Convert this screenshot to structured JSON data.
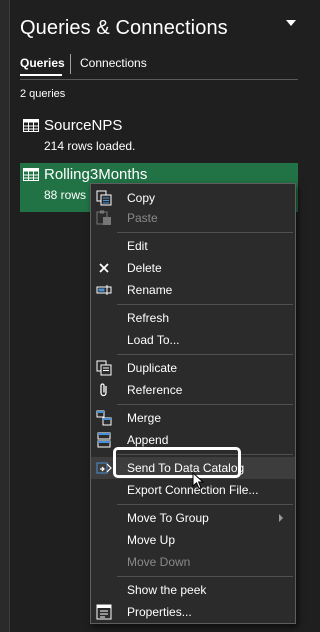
{
  "pane": {
    "title": "Queries & Connections",
    "tabs": [
      {
        "label": "Queries",
        "active": true
      },
      {
        "label": "Connections",
        "active": false
      }
    ],
    "count_text": "2 queries"
  },
  "queries": [
    {
      "name": "SourceNPS",
      "status": "214 rows loaded.",
      "selected": false
    },
    {
      "name": "Rolling3Months",
      "status": "88 rows",
      "selected": true
    }
  ],
  "context_menu": {
    "items": [
      {
        "label": "Copy",
        "icon": "copy-icon",
        "enabled": true
      },
      {
        "label": "Paste",
        "icon": "paste-icon",
        "enabled": false
      },
      {
        "label": "Edit",
        "icon": "",
        "enabled": true
      },
      {
        "label": "Delete",
        "icon": "delete-icon",
        "enabled": true
      },
      {
        "label": "Rename",
        "icon": "rename-icon",
        "enabled": true
      },
      {
        "label": "Refresh",
        "icon": "",
        "enabled": true
      },
      {
        "label": "Load To...",
        "icon": "",
        "enabled": true
      },
      {
        "label": "Duplicate",
        "icon": "duplicate-icon",
        "enabled": true
      },
      {
        "label": "Reference",
        "icon": "reference-icon",
        "enabled": true
      },
      {
        "label": "Merge",
        "icon": "merge-icon",
        "enabled": true
      },
      {
        "label": "Append",
        "icon": "append-icon",
        "enabled": true
      },
      {
        "label": "Send To Data Catalog",
        "icon": "data-catalog-icon",
        "enabled": true,
        "highlighted": true
      },
      {
        "label": "Export Connection File...",
        "icon": "",
        "enabled": true
      },
      {
        "label": "Move To Group",
        "icon": "",
        "enabled": true,
        "submenu": true
      },
      {
        "label": "Move Up",
        "icon": "",
        "enabled": true
      },
      {
        "label": "Move Down",
        "icon": "",
        "enabled": false
      },
      {
        "label": "Show the peek",
        "icon": "",
        "enabled": true
      },
      {
        "label": "Properties...",
        "icon": "properties-icon",
        "enabled": true
      }
    ]
  },
  "colors": {
    "background": "#1f1f1f",
    "selected_row": "#217346",
    "menu_background": "#2b2b2b",
    "disabled_text": "#8a8a8a"
  }
}
